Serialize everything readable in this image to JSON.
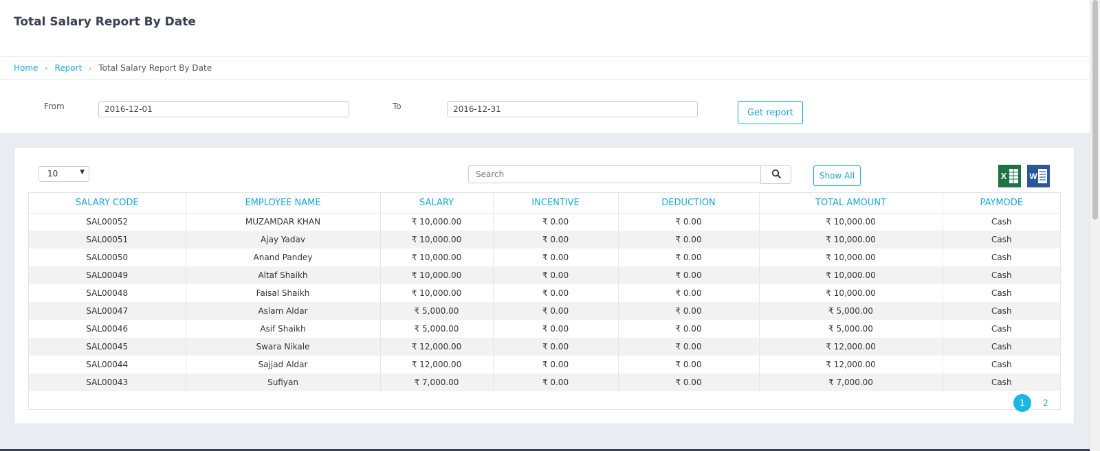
{
  "page": {
    "title": "Total Salary Report By Date"
  },
  "breadcrumb": {
    "home": "Home",
    "report": "Report",
    "current": "Total Salary Report By Date",
    "separator": "›"
  },
  "filter": {
    "from_label": "From",
    "from_value": "2016-12-01",
    "to_label": "To",
    "to_value": "2016-12-31",
    "button": "Get report"
  },
  "toolbar": {
    "page_size": "10",
    "search_placeholder": "Search",
    "show_all": "Show All",
    "excel_letter": "X",
    "word_letter": "W"
  },
  "table": {
    "headers": [
      "SALARY CODE",
      "EMPLOYEE NAME",
      "SALARY",
      "INCENTIVE",
      "DEDUCTION",
      "TOTAL AMOUNT",
      "PAYMODE"
    ],
    "rows": [
      [
        "SAL00052",
        "MUZAMDAR KHAN",
        "₹ 10,000.00",
        "₹ 0.00",
        "₹ 0.00",
        "₹ 10,000.00",
        "Cash"
      ],
      [
        "SAL00051",
        "Ajay Yadav",
        "₹ 10,000.00",
        "₹ 0.00",
        "₹ 0.00",
        "₹ 10,000.00",
        "Cash"
      ],
      [
        "SAL00050",
        "Anand Pandey",
        "₹ 10,000.00",
        "₹ 0.00",
        "₹ 0.00",
        "₹ 10,000.00",
        "Cash"
      ],
      [
        "SAL00049",
        "Altaf Shaikh",
        "₹ 10,000.00",
        "₹ 0.00",
        "₹ 0.00",
        "₹ 10,000.00",
        "Cash"
      ],
      [
        "SAL00048",
        "Faisal Shaikh",
        "₹ 10,000.00",
        "₹ 0.00",
        "₹ 0.00",
        "₹ 10,000.00",
        "Cash"
      ],
      [
        "SAL00047",
        "Aslam Aldar",
        "₹ 5,000.00",
        "₹ 0.00",
        "₹ 0.00",
        "₹ 5,000.00",
        "Cash"
      ],
      [
        "SAL00046",
        "Asif Shaikh",
        "₹ 5,000.00",
        "₹ 0.00",
        "₹ 0.00",
        "₹ 5,000.00",
        "Cash"
      ],
      [
        "SAL00045",
        "Swara Nikale",
        "₹ 12,000.00",
        "₹ 0.00",
        "₹ 0.00",
        "₹ 12,000.00",
        "Cash"
      ],
      [
        "SAL00044",
        "Sajjad Aldar",
        "₹ 12,000.00",
        "₹ 0.00",
        "₹ 0.00",
        "₹ 12,000.00",
        "Cash"
      ],
      [
        "SAL00043",
        "Sufiyan",
        "₹ 7,000.00",
        "₹ 0.00",
        "₹ 0.00",
        "₹ 7,000.00",
        "Cash"
      ]
    ]
  },
  "pagination": {
    "pages": [
      "1",
      "2"
    ],
    "active": "1"
  },
  "colors": {
    "accent": "#1aa7d9",
    "excel": "#1f7244",
    "word": "#2b579a",
    "footer": "#3a3f51"
  }
}
